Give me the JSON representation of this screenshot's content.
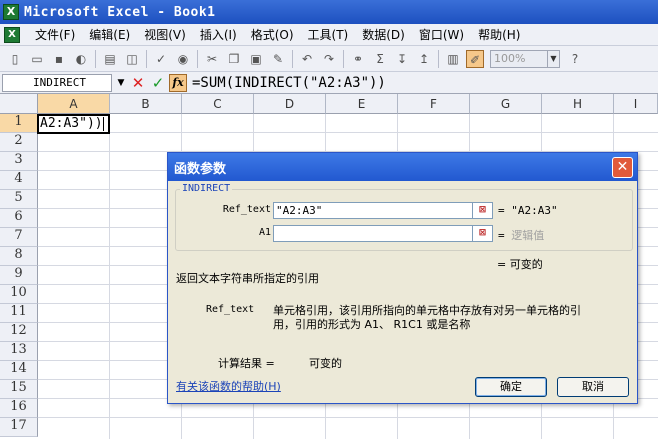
{
  "window": {
    "title": "Microsoft Excel - Book1"
  },
  "menu": [
    "文件(F)",
    "编辑(E)",
    "视图(V)",
    "插入(I)",
    "格式(O)",
    "工具(T)",
    "数据(D)",
    "窗口(W)",
    "帮助(H)"
  ],
  "toolbar": {
    "zoom": "100%"
  },
  "formula_bar": {
    "name_box": "INDIRECT",
    "cancel": "✕",
    "enter": "✓",
    "fx": "fx",
    "formula": "=SUM(INDIRECT(\"A2:A3\"))"
  },
  "sheet": {
    "columns": [
      "A",
      "B",
      "C",
      "D",
      "E",
      "F",
      "G",
      "H",
      "I"
    ],
    "rows": [
      "1",
      "2",
      "3",
      "4",
      "5",
      "6",
      "7",
      "8",
      "9",
      "10",
      "11",
      "12",
      "13",
      "14",
      "15",
      "16",
      "17"
    ],
    "active_cell_text": "A2:A3\"))"
  },
  "dialog": {
    "title": "函数参数",
    "close": "✕",
    "function_name": "INDIRECT",
    "args": [
      {
        "label": "Ref_text",
        "value": "\"A2:A3\"",
        "result": "= \"A2:A3\""
      },
      {
        "label": "A1",
        "value": "",
        "result_prefix": "=",
        "result": "逻辑值"
      }
    ],
    "overall_result": "= 可变的",
    "description": "返回文本字符串所指定的引用",
    "arg_help_name": "Ref_text",
    "arg_help_line1": "单元格引用，该引用所指向的单元格中存放有对另一单元格的引",
    "arg_help_line2": "用，引用的形式为 A1、 R1C1 或是名称",
    "calc_label": "计算结果 =",
    "calc_value": "可变的",
    "help_link": "有关该函数的帮助(H)",
    "ok": "确定",
    "cancel": "取消"
  },
  "colors": {
    "titlebar": "#2258d0",
    "selection_header": "#f9d9a6",
    "dialog_bg": "#ece9d8"
  }
}
